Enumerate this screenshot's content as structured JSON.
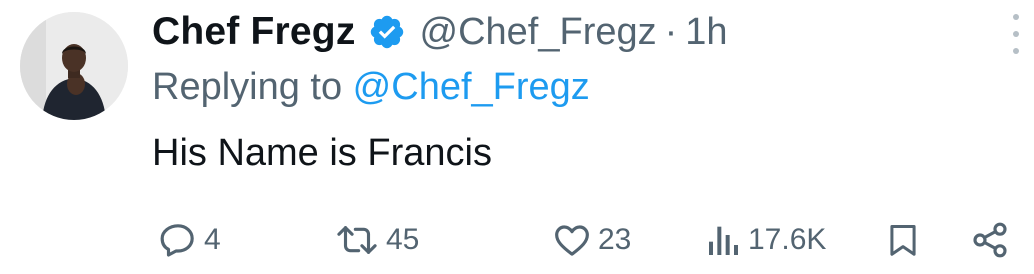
{
  "author": {
    "name": "Chef Fregz",
    "handle": "@Chef_Fregz",
    "separator": "·",
    "time": "1h",
    "verified": true
  },
  "reply": {
    "prefix": "Replying to ",
    "mention": "@Chef_Fregz"
  },
  "content": {
    "text": "His Name is Francis"
  },
  "actions": {
    "replies": "4",
    "reposts": "45",
    "likes": "23",
    "views": "17.6K"
  },
  "icons": {
    "verified": "verified-badge-icon",
    "more": "more-options-icon",
    "reply": "reply-icon",
    "repost": "repost-icon",
    "like": "heart-icon",
    "views": "views-chart-icon",
    "bookmark": "bookmark-icon",
    "share": "share-icon"
  },
  "colors": {
    "text": "#0f1419",
    "secondary": "#536471",
    "accent": "#1d9bf0"
  }
}
